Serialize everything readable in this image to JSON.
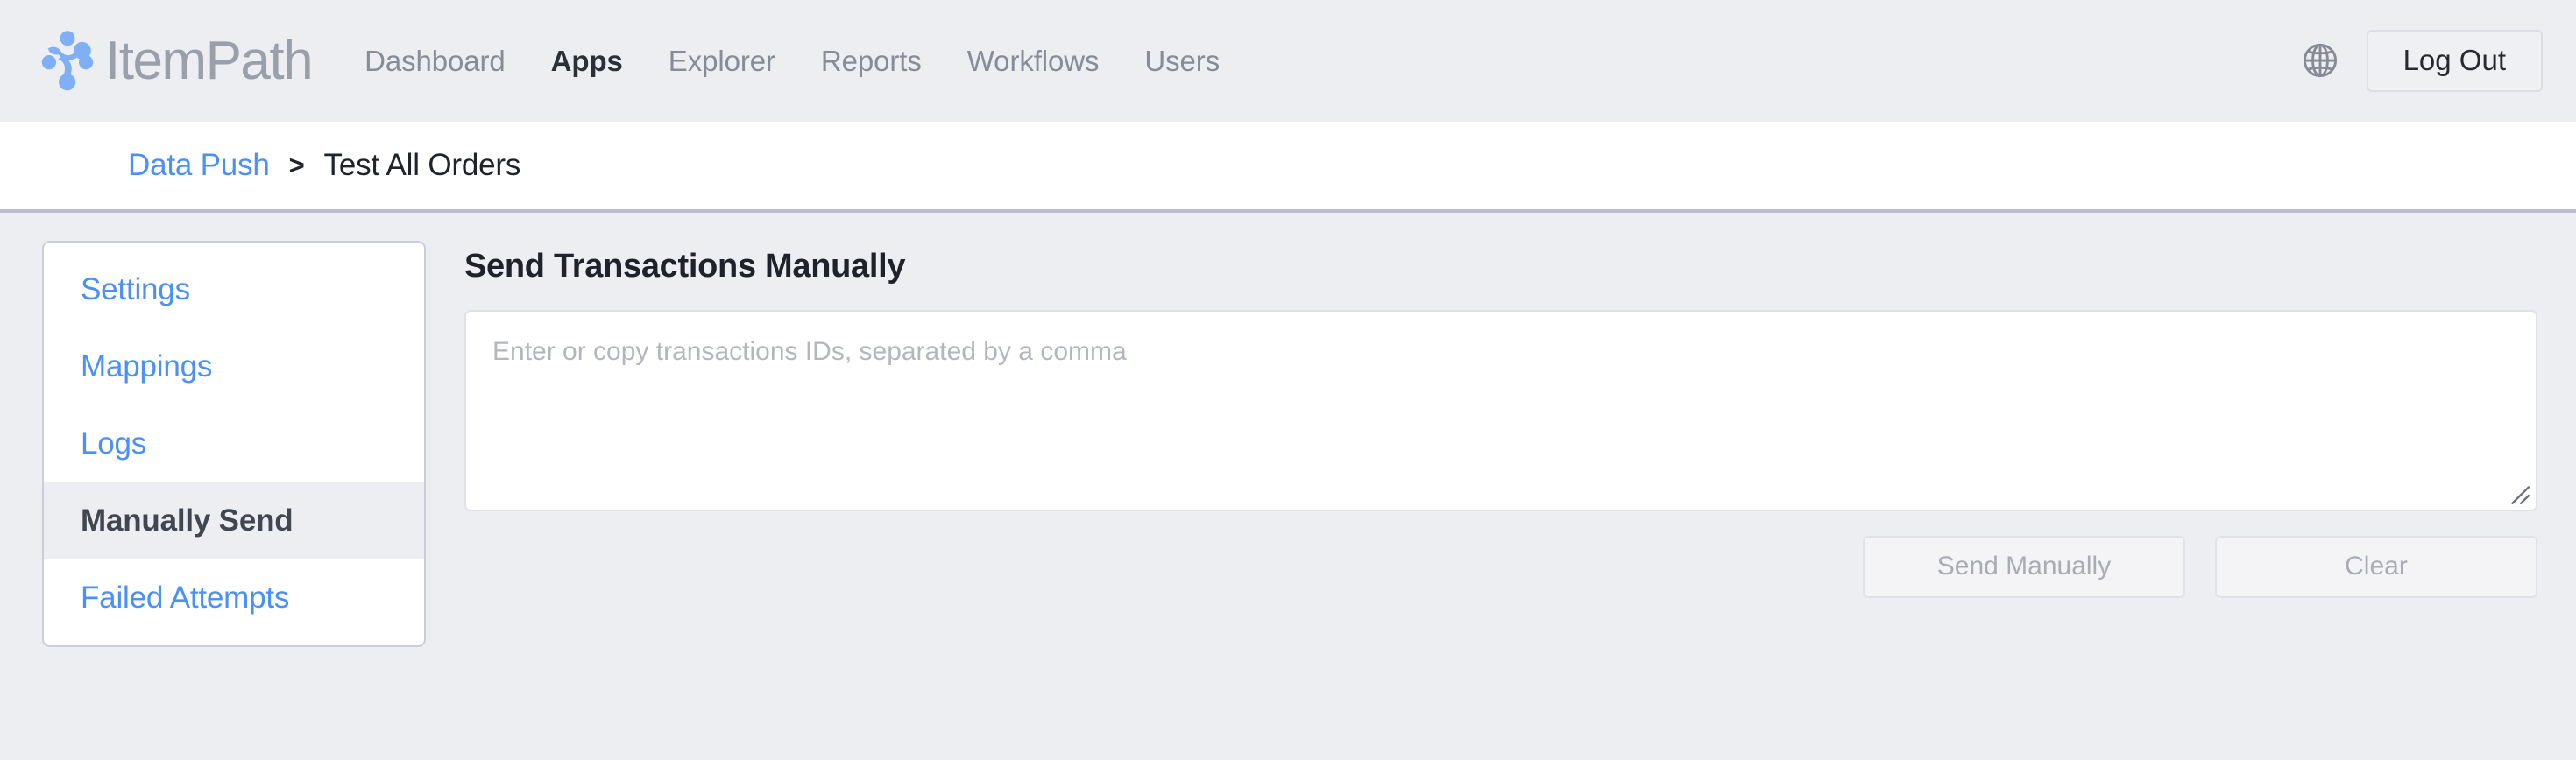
{
  "header": {
    "brand_name": "ItemPath",
    "brand_icon": "itempath-logo-icon",
    "nav": [
      {
        "label": "Dashboard",
        "active": false
      },
      {
        "label": "Apps",
        "active": true
      },
      {
        "label": "Explorer",
        "active": false
      },
      {
        "label": "Reports",
        "active": false
      },
      {
        "label": "Workflows",
        "active": false
      },
      {
        "label": "Users",
        "active": false
      }
    ],
    "language_icon": "globe-icon",
    "logout_label": "Log Out",
    "colors": {
      "background": "#edeef2",
      "brand_blue": "#7fb0f6",
      "brand_gray": "#9aa0a9",
      "nav_inactive": "#878d96",
      "nav_active": "#2b2f36"
    }
  },
  "breadcrumb": {
    "parent_label": "Data Push",
    "separator": ">",
    "current_label": "Test All Orders",
    "link_color": "#4a90f7",
    "current_color": "#20232a"
  },
  "sidebar": {
    "items": [
      {
        "label": "Settings",
        "active": false
      },
      {
        "label": "Mappings",
        "active": false
      },
      {
        "label": "Logs",
        "active": false
      },
      {
        "label": "Manually Send",
        "active": true
      },
      {
        "label": "Failed Attempts",
        "active": false
      }
    ],
    "link_color": "#4a90f7",
    "active_color": "#42474f",
    "active_background": "#eceef2"
  },
  "main": {
    "title": "Send Transactions Manually",
    "textarea": {
      "value": "",
      "placeholder": "Enter or copy transactions IDs, separated by a comma",
      "resize_handle_icon": "resize-grip-icon"
    },
    "buttons": [
      {
        "label": "Send Manually",
        "disabled": true
      },
      {
        "label": "Clear",
        "disabled": true
      }
    ]
  }
}
